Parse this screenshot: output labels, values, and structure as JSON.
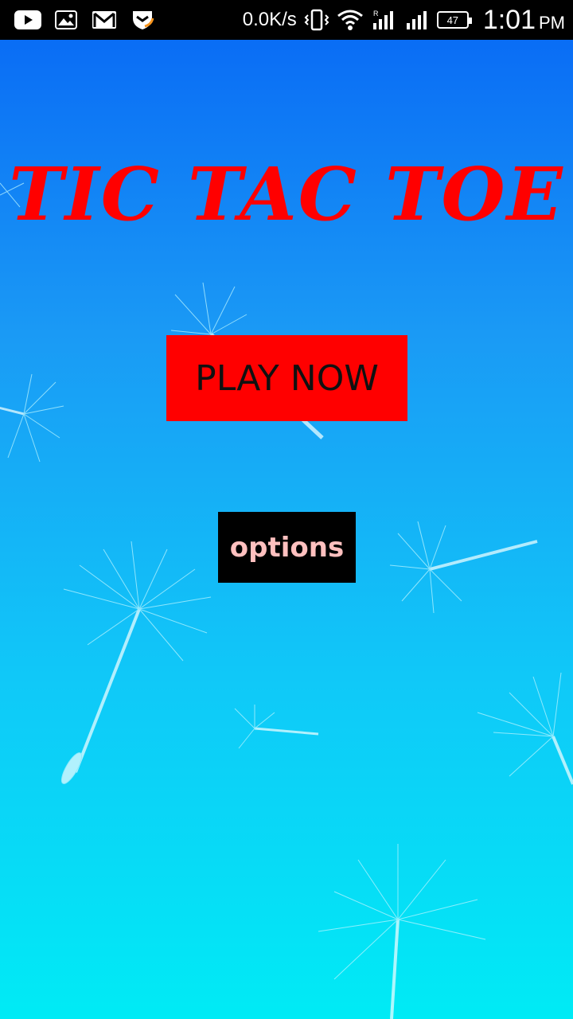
{
  "status_bar": {
    "network_speed": "0.0K/s",
    "battery_level": "47",
    "time": "1:01",
    "ampm": "PM",
    "icons": [
      "youtube-icon",
      "gallery-icon",
      "gmail-icon",
      "security-app-icon",
      "vibrate-icon",
      "wifi-icon",
      "signal-sim1-icon",
      "signal-sim2-icon",
      "battery-icon"
    ]
  },
  "screen": {
    "title": "TIC TAC TOE",
    "play_label": "PLAY NOW",
    "options_label": "options"
  },
  "colors": {
    "title": "#ff0000",
    "play_bg": "#ff0000",
    "play_text": "#111111",
    "options_bg": "#000000",
    "options_text": "#ffc0bf",
    "bg_top": "#0a6df5",
    "bg_bottom": "#00ebf5"
  }
}
